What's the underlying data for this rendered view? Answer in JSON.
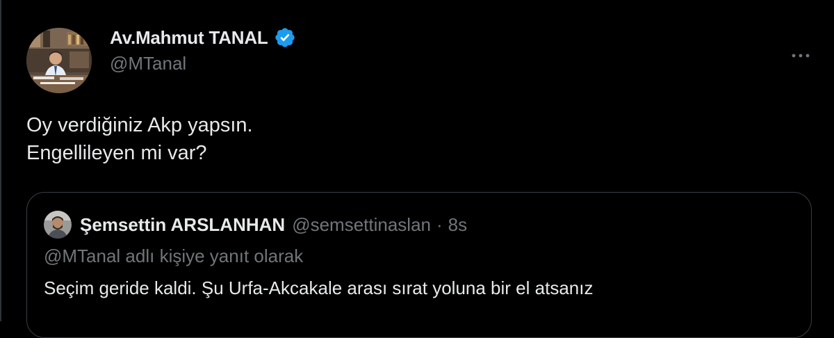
{
  "author": {
    "name": "Av.Mahmut TANAL",
    "handle": "@MTanal",
    "verified": true,
    "avatar_icon": "profile-photo-avatar",
    "verified_icon": "verified-badge-icon",
    "verified_color": "#1d9bf0"
  },
  "more_icon": "more-options-icon",
  "tweet": {
    "lines": [
      "Oy verdiğiniz Akp yapsın.",
      "Engellileyen mi var?"
    ]
  },
  "quote": {
    "name": "Şemsettin ARSLANHAN",
    "handle": "@semsettinaslan",
    "separator": "·",
    "time": "8s",
    "avatar_icon": "profile-photo-avatar",
    "reply_context": "@MTanal adlı kişiye yanıt olarak",
    "text": "Seçim geride kaldi. Şu Urfa-Akcakale arası sırat yoluna bir el atsanız"
  },
  "colors": {
    "background": "#000000",
    "text_primary": "#e7e9ea",
    "text_secondary": "#71767b",
    "border": "#3a3f44"
  }
}
